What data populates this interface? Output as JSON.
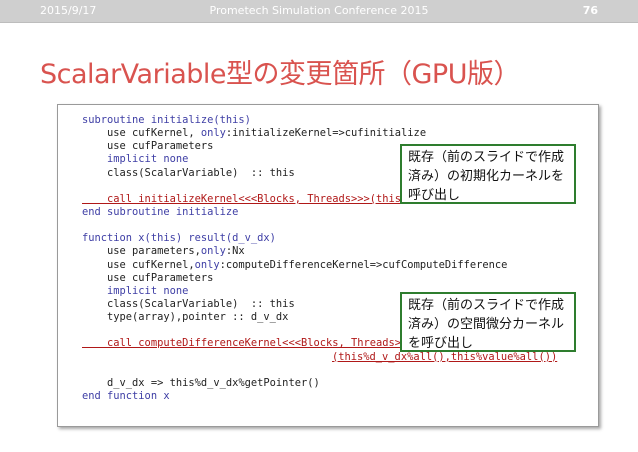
{
  "header": {
    "date": "2015/9/17",
    "conference": "Prometech Simulation Conference 2015",
    "page_number": "76"
  },
  "title": "ScalarVariable型の変更箇所（GPU版）",
  "code": {
    "l1": "subroutine initialize(this)",
    "l2_a": "    use cufKernel, ",
    "l2_b": "only",
    "l2_c": ":initializeKernel=>cufinitialize",
    "l3": "    use cufParameters",
    "l4": "    implicit none",
    "l5": "    class(ScalarVariable)  :: this",
    "l6": "",
    "l7": "    call initializeKernel<<<Blocks, Threads>>>(this%value%all())",
    "l8": "end subroutine initialize",
    "l9": "",
    "l10": "function x(this) result(d_v_dx)",
    "l11_a": "    use parameters,",
    "l11_b": "only",
    "l11_c": ":Nx",
    "l12_a": "    use cufKernel,",
    "l12_b": "only",
    "l12_c": ":computeDifferenceKernel=>cufComputeDifference",
    "l13": "    use cufParameters",
    "l14": "    implicit none",
    "l15": "    class(ScalarVariable)  :: this",
    "l16": "    type(array),pointer :: d_v_dx",
    "l17": "",
    "l18": "    call computeDifferenceKernel<<<Blocks, Threads>>>",
    "l19": "(this%d_v_dx%all(),this%value%all())",
    "l20": "",
    "l21": "    d_v_dx => this%d_v_dx%getPointer()",
    "l22": "end function x"
  },
  "callouts": {
    "first": [
      "既存（前のスライドで作成",
      "済み）の初期化カーネルを",
      "呼び出し"
    ],
    "second": [
      "既存（前のスライドで作成",
      "済み）の空間微分カーネル",
      "を呼び出し"
    ]
  }
}
